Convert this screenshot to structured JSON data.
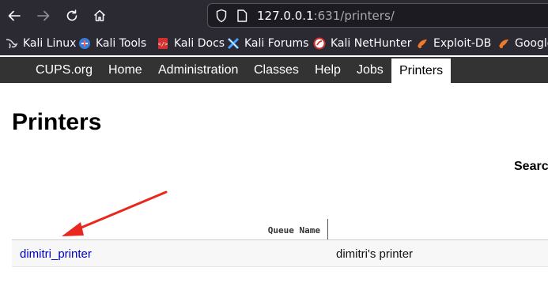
{
  "browser": {
    "url_host": "127.0.0.1",
    "url_rest": ":631/printers/",
    "icons": {
      "back": "arrow-left-icon",
      "forward": "arrow-right-icon",
      "reload": "reload-icon",
      "home": "home-icon",
      "security": "shield-icon",
      "page": "page-icon"
    }
  },
  "bookmarks": [
    {
      "label": "Kali Linux",
      "icon": "kali-dragon-icon"
    },
    {
      "label": "Kali Tools",
      "icon": "kali-tools-icon"
    },
    {
      "label": "Kali Docs",
      "icon": "kali-docs-icon"
    },
    {
      "label": "Kali Forums",
      "icon": "kali-forums-icon"
    },
    {
      "label": "Kali NetHunter",
      "icon": "nethunter-icon"
    },
    {
      "label": "Exploit-DB",
      "icon": "exploit-db-icon"
    },
    {
      "label": "Google",
      "icon": "google-hacking-db-icon"
    }
  ],
  "cups_nav": [
    {
      "label": "CUPS.org"
    },
    {
      "label": "Home"
    },
    {
      "label": "Administration"
    },
    {
      "label": "Classes"
    },
    {
      "label": "Help"
    },
    {
      "label": "Jobs"
    },
    {
      "label": "Printers",
      "active": true
    }
  ],
  "page": {
    "title": "Printers",
    "search_label": "Search"
  },
  "table": {
    "headers": [
      "Queue Name"
    ],
    "rows": [
      {
        "queue": "dimitri_printer",
        "description": "dimitri's printer"
      }
    ]
  },
  "annotation": {
    "arrow_color": "#e8281e"
  },
  "colors": {
    "browser_chrome": "#2b2a33",
    "cups_nav": "#333333",
    "link": "#0000c0"
  }
}
